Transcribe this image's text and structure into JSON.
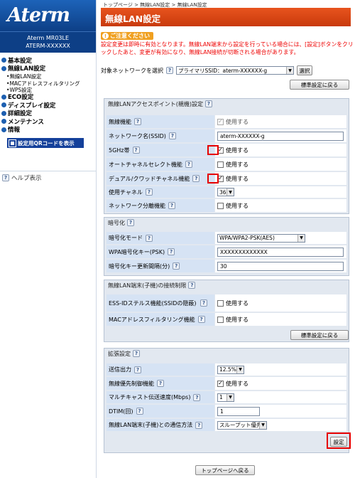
{
  "sidebar": {
    "logo": "Aterm",
    "model_line1": "Aterm MR03LE",
    "model_line2": "ATERM-XXXXXX",
    "items": [
      {
        "label": "基本設定",
        "type": "top"
      },
      {
        "label": "無線LAN設定",
        "type": "top"
      },
      {
        "label": "無線LAN設定",
        "type": "sub"
      },
      {
        "label": "MACアドレスフィルタリング",
        "type": "sub"
      },
      {
        "label": "WPS設定",
        "type": "sub"
      },
      {
        "label": "ECO設定",
        "type": "top"
      },
      {
        "label": "ディスプレイ設定",
        "type": "top"
      },
      {
        "label": "詳細設定",
        "type": "top"
      },
      {
        "label": "メンテナンス",
        "type": "top"
      },
      {
        "label": "情報",
        "type": "top"
      }
    ],
    "qr_label": "設定用QRコードを表示",
    "help_label": "ヘルプ表示"
  },
  "breadcrumb": "トップページ > 無線LAN設定 > 無線LAN設定",
  "page_title": "無線LAN設定",
  "caution": {
    "badge": "ご注意ください",
    "text": "設定変更は即時に有効となります。無線LAN端末から設定を行っている場合には、[設定]ボタンをクリックしたあと、変更が有効になり、無線LAN接続が切断される場合があります。"
  },
  "target_network": {
    "label": "対象ネットワークを選択",
    "value": "プライマリSSID：aterm-XXXXXX-g",
    "select_button": "選択"
  },
  "reset_button": "標準設定に戻る",
  "q_mark": "?",
  "sections": {
    "ap": {
      "title": "無線LANアクセスポイント(親機)設定",
      "rows": {
        "wireless": {
          "label": "無線機能",
          "value": "使用する",
          "checked": true
        },
        "ssid": {
          "label": "ネットワーク名(SSID)",
          "value": "aterm-XXXXXX-g"
        },
        "band5": {
          "label": "5GHz帯",
          "value": "使用する",
          "checked": true
        },
        "auto_ch": {
          "label": "オートチャネルセレクト機能",
          "value": "使用する",
          "checked": false
        },
        "dual": {
          "label": "デュアル/クワッドチャネル機能",
          "value": "使用する",
          "checked": true
        },
        "channel": {
          "label": "使用チャネル",
          "value": "36"
        },
        "separate": {
          "label": "ネットワーク分離機能",
          "value": "使用する",
          "checked": false
        }
      }
    },
    "enc": {
      "title": "暗号化",
      "rows": {
        "mode": {
          "label": "暗号化モード",
          "value": "WPA/WPA2-PSK(AES)"
        },
        "key": {
          "label": "WPA暗号化キー(PSK)",
          "value": "XXXXXXXXXXXXX"
        },
        "interval": {
          "label": "暗号化キー更新間隔(分)",
          "value": "30"
        }
      }
    },
    "limit": {
      "title": "無線LAN端末(子機)の接続制限",
      "rows": {
        "stealth": {
          "label": "ESS-IDステルス機能(SSIDの隠蔽)",
          "value": "使用する",
          "checked": false
        },
        "mac": {
          "label": "MACアドレスフィルタリング機能",
          "value": "使用する",
          "checked": false
        }
      }
    },
    "ext": {
      "title": "拡張設定",
      "rows": {
        "power": {
          "label": "送信出力",
          "value": "12.5%"
        },
        "priority": {
          "label": "無線優先制御機能",
          "value": "使用する",
          "checked": true
        },
        "multicast": {
          "label": "マルチキャスト伝送速度(Mbps)",
          "value": "1"
        },
        "dtim": {
          "label": "DTIM(回)",
          "value": "1"
        },
        "comm": {
          "label": "無線LAN端末(子機)との通信方法",
          "value": "スループット優先"
        }
      }
    }
  },
  "apply_button": "設定",
  "back_button": "トップページへ戻る",
  "colors": {
    "title": "#e0521c",
    "sidebar": "#0d3f86",
    "highlight": "#e60000"
  }
}
